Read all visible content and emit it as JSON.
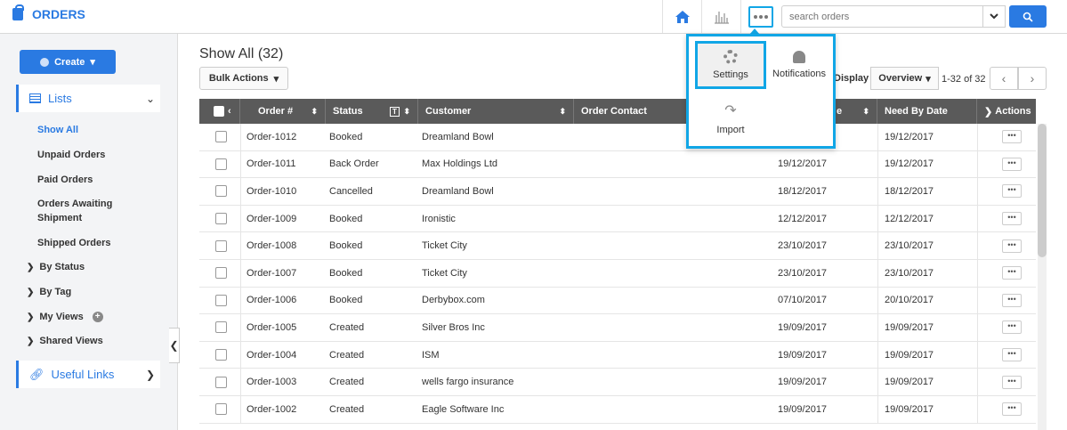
{
  "header": {
    "title": "ORDERS",
    "search_placeholder": "search orders"
  },
  "popup": {
    "settings": "Settings",
    "notifications": "Notifications",
    "import": "Import"
  },
  "sidebar": {
    "create_label": "Create",
    "lists_label": "Lists",
    "items": [
      {
        "label": "Show All"
      },
      {
        "label": "Unpaid Orders"
      },
      {
        "label": "Paid Orders"
      },
      {
        "label": "Orders Awaiting Shipment"
      },
      {
        "label": "Shipped Orders"
      }
    ],
    "groups": [
      {
        "label": "By Status"
      },
      {
        "label": "By Tag"
      },
      {
        "label": "My Views"
      },
      {
        "label": "Shared Views"
      }
    ],
    "useful_links": "Useful Links"
  },
  "main": {
    "title": "Show All (32)",
    "bulk_actions": "Bulk Actions",
    "display_label": "Display",
    "display_value": "Overview",
    "pager": "1-32 of 32"
  },
  "table": {
    "headers": {
      "order": "Order #",
      "status": "Status",
      "customer": "Customer",
      "contact": "Order Contact",
      "date": "e",
      "need_by": "Need By Date",
      "actions": "Actions"
    },
    "rows": [
      {
        "order": "Order-1012",
        "status": "Booked",
        "customer": "Dreamland Bowl",
        "date": "",
        "need_by": "19/12/2017"
      },
      {
        "order": "Order-1011",
        "status": "Back Order",
        "customer": "Max Holdings Ltd",
        "date": "19/12/2017",
        "need_by": "19/12/2017"
      },
      {
        "order": "Order-1010",
        "status": "Cancelled",
        "customer": "Dreamland Bowl",
        "date": "18/12/2017",
        "need_by": "18/12/2017"
      },
      {
        "order": "Order-1009",
        "status": "Booked",
        "customer": "Ironistic",
        "date": "12/12/2017",
        "need_by": "12/12/2017"
      },
      {
        "order": "Order-1008",
        "status": "Booked",
        "customer": "Ticket City",
        "date": "23/10/2017",
        "need_by": "23/10/2017"
      },
      {
        "order": "Order-1007",
        "status": "Booked",
        "customer": "Ticket City",
        "date": "23/10/2017",
        "need_by": "23/10/2017"
      },
      {
        "order": "Order-1006",
        "status": "Booked",
        "customer": "Derbybox.com",
        "date": "07/10/2017",
        "need_by": "20/10/2017"
      },
      {
        "order": "Order-1005",
        "status": "Created",
        "customer": "Silver Bros Inc",
        "date": "19/09/2017",
        "need_by": "19/09/2017"
      },
      {
        "order": "Order-1004",
        "status": "Created",
        "customer": "ISM",
        "date": "19/09/2017",
        "need_by": "19/09/2017"
      },
      {
        "order": "Order-1003",
        "status": "Created",
        "customer": "wells fargo insurance",
        "date": "19/09/2017",
        "need_by": "19/09/2017"
      },
      {
        "order": "Order-1002",
        "status": "Created",
        "customer": "Eagle Software Inc",
        "date": "19/09/2017",
        "need_by": "19/09/2017"
      }
    ]
  }
}
